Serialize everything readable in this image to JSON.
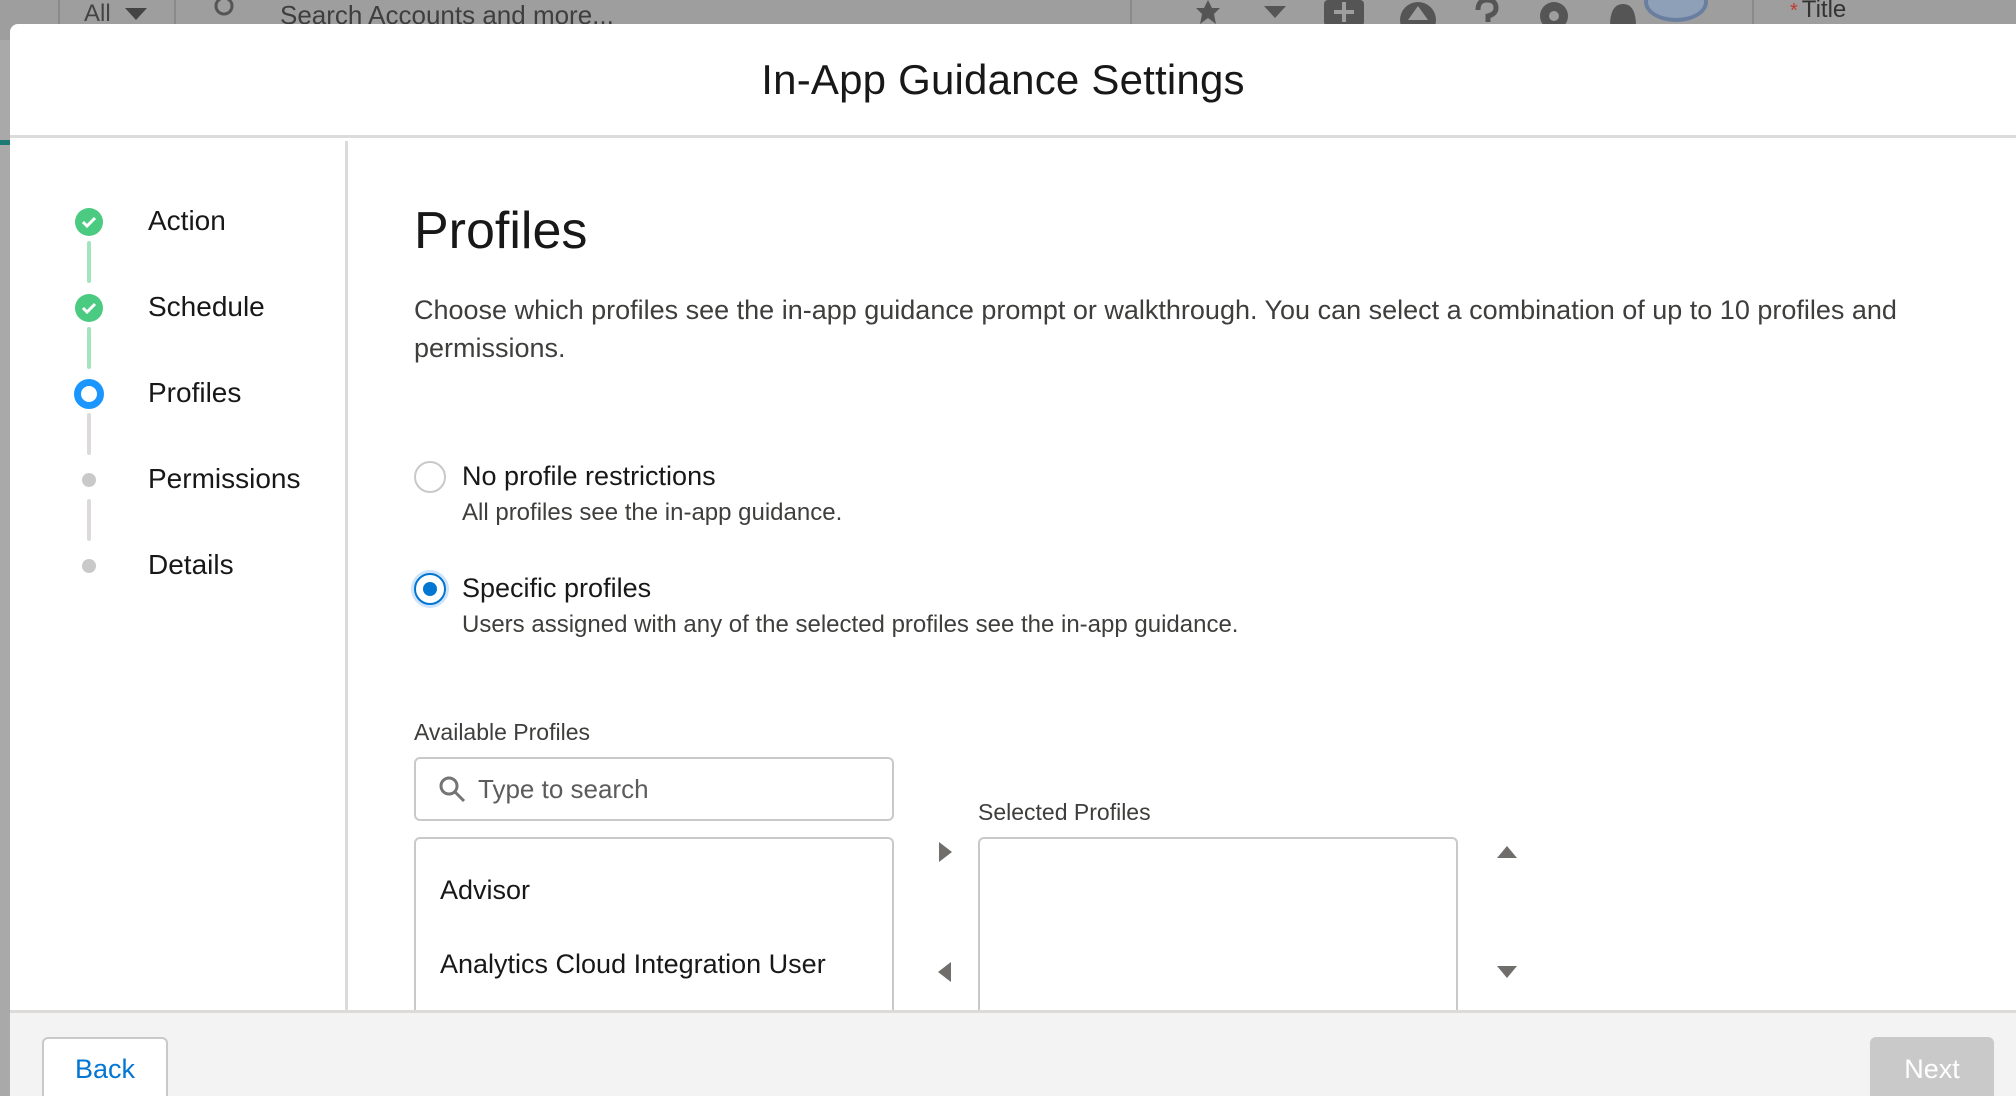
{
  "background": {
    "scope_label": "All",
    "search_placeholder": "Search Accounts and more...",
    "title_field_required": "*",
    "title_field_label": "Title"
  },
  "modal": {
    "title": "In-App Guidance Settings"
  },
  "steps": [
    {
      "label": "Action",
      "status": "complete"
    },
    {
      "label": "Schedule",
      "status": "complete"
    },
    {
      "label": "Profiles",
      "status": "current"
    },
    {
      "label": "Permissions",
      "status": "incomplete"
    },
    {
      "label": "Details",
      "status": "incomplete"
    }
  ],
  "content": {
    "heading": "Profiles",
    "description": "Choose which profiles see the in-app guidance prompt or walkthrough. You can select a combination of up to 10 profiles and permissions.",
    "options": [
      {
        "title": "No profile restrictions",
        "subtitle": "All profiles see the in-app guidance.",
        "selected": false
      },
      {
        "title": "Specific profiles",
        "subtitle": "Users assigned with any of the selected profiles see the in-app guidance.",
        "selected": true
      }
    ],
    "available_label": "Available Profiles",
    "search_placeholder": "Type to search",
    "available_items": [
      "Advisor",
      "Analytics Cloud Integration User"
    ],
    "selected_label": "Selected Profiles",
    "selected_items": []
  },
  "footer": {
    "back_label": "Back",
    "next_label": "Next"
  },
  "colors": {
    "brand": "#0176d3",
    "complete": "#4bca81",
    "current": "#1b96ff",
    "disabled": "#c9c9c9"
  }
}
